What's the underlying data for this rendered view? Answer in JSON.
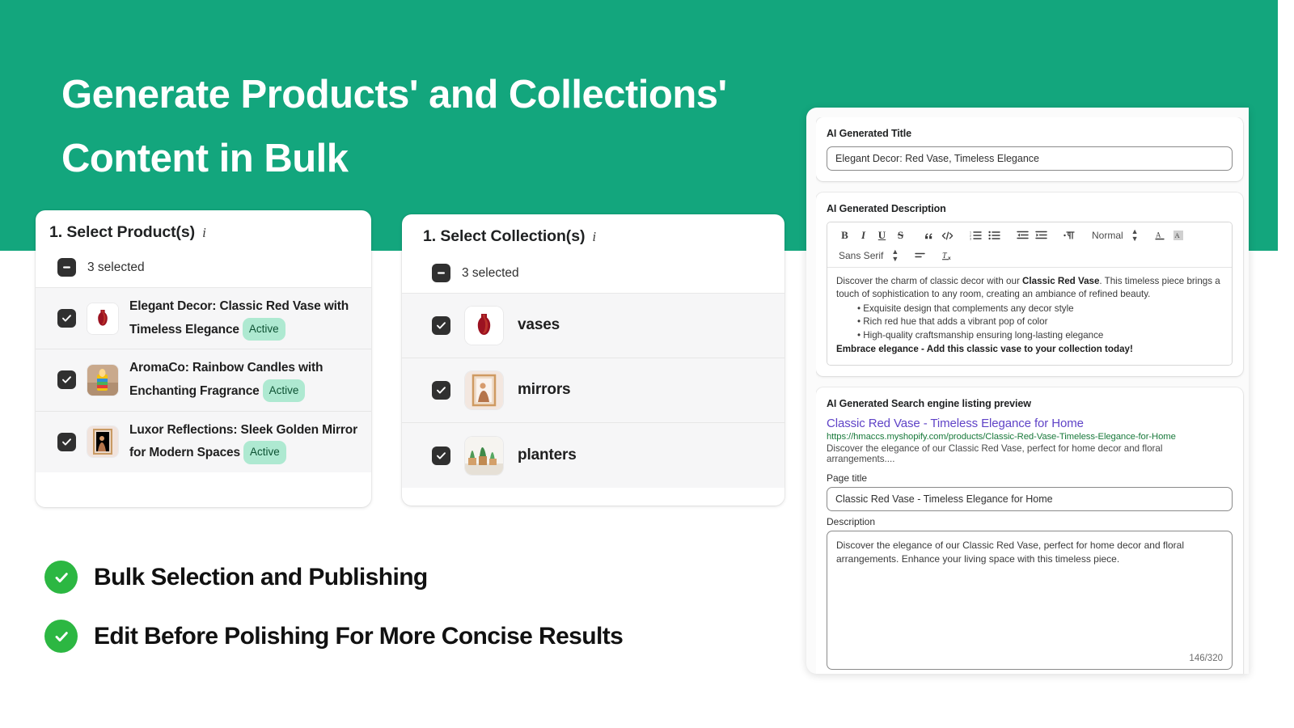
{
  "theme": {
    "brand_green": "#13a67d",
    "badge_bg": "#aee9d1",
    "badge_text": "#0c5132",
    "check_green": "#2cb742",
    "seo_link": "#5f43c7",
    "seo_url": "#1a7a3c"
  },
  "hero": {
    "title": "Generate Products' and Collections' Content in Bulk"
  },
  "products_panel": {
    "title": "1. Select Product(s)",
    "info_icon": "info-icon",
    "summary": "3 selected",
    "rows": [
      {
        "name": "Elegant Decor: Classic Red Vase with Timeless Elegance",
        "badge": "Active",
        "thumb": "red-vase-thumbnail"
      },
      {
        "name": "AromaCo: Rainbow Candles with Enchanting Fragrance",
        "badge": "Active",
        "thumb": "rainbow-candle-thumbnail"
      },
      {
        "name": "Luxor Reflections: Sleek Golden Mirror for Modern Spaces",
        "badge": "Active",
        "thumb": "golden-mirror-thumbnail"
      }
    ]
  },
  "collections_panel": {
    "title": "1. Select Collection(s)",
    "info_icon": "info-icon",
    "summary": "3 selected",
    "rows": [
      {
        "name": "vases",
        "thumb": "red-vase-thumbnail"
      },
      {
        "name": "mirrors",
        "thumb": "framed-mirror-thumbnail"
      },
      {
        "name": "planters",
        "thumb": "planters-thumbnail"
      }
    ]
  },
  "features": [
    {
      "icon": "check-circle-icon",
      "label": "Bulk Selection and Publishing"
    },
    {
      "icon": "check-circle-icon",
      "label": "Edit Before Polishing For More Concise Results"
    }
  ],
  "app_panel": {
    "title_card": {
      "label": "AI Generated Title",
      "value": "Elegant Decor: Red Vase, Timeless Elegance"
    },
    "description_card": {
      "label": "AI Generated Description",
      "toolbar": {
        "row1": [
          {
            "icon": "bold-icon",
            "glyph": "B"
          },
          {
            "icon": "italic-icon",
            "glyph": "I"
          },
          {
            "icon": "underline-icon",
            "glyph": "U"
          },
          {
            "icon": "strikethrough-icon",
            "glyph": "S"
          },
          {
            "icon": "blockquote-icon",
            "glyph": "”"
          },
          {
            "icon": "code-block-icon",
            "glyph": "</>"
          },
          {
            "icon": "ordered-list-icon",
            "glyph": "list"
          },
          {
            "icon": "bullet-list-icon",
            "glyph": "list"
          },
          {
            "icon": "outdent-icon",
            "glyph": "indent"
          },
          {
            "icon": "indent-icon",
            "glyph": "indent"
          },
          {
            "icon": "text-direction-icon",
            "glyph": "¶"
          }
        ],
        "heading_select": "Normal",
        "text_color_icon": "text-color-icon",
        "background_color_icon": "background-color-icon",
        "font_select": "Sans Serif",
        "align_icon": "align-icon",
        "clear_format_icon": "clear-formatting-icon"
      },
      "body": {
        "intro_before": "Discover the charm of classic decor with our ",
        "intro_bold": "Classic Red Vase",
        "intro_after": ". This timeless piece brings a touch of sophistication to any room, creating an ambiance of refined beauty.",
        "bullets": [
          "Exquisite design that complements any decor style",
          "Rich red hue that adds a vibrant pop of color",
          "High-quality craftsmanship ensuring long-lasting elegance"
        ],
        "closing": "Embrace elegance - Add this classic vase to your collection today!"
      }
    },
    "seo_card": {
      "label": "AI Generated Search engine listing preview",
      "preview_title": "Classic Red Vase - Timeless Elegance for Home",
      "preview_url": "https://hmaccs.myshopify.com/products/Classic-Red-Vase-Timeless-Elegance-for-Home",
      "preview_description": "Discover the elegance of our Classic Red Vase, perfect for home decor and floral arrangements....",
      "page_title_label": "Page title",
      "page_title_value": "Classic Red Vase - Timeless Elegance for Home",
      "description_label": "Description",
      "description_value": "Discover the elegance of our Classic Red Vase, perfect for home decor and floral arrangements. Enhance your living space with this timeless piece.",
      "char_counter": "146/320"
    }
  }
}
